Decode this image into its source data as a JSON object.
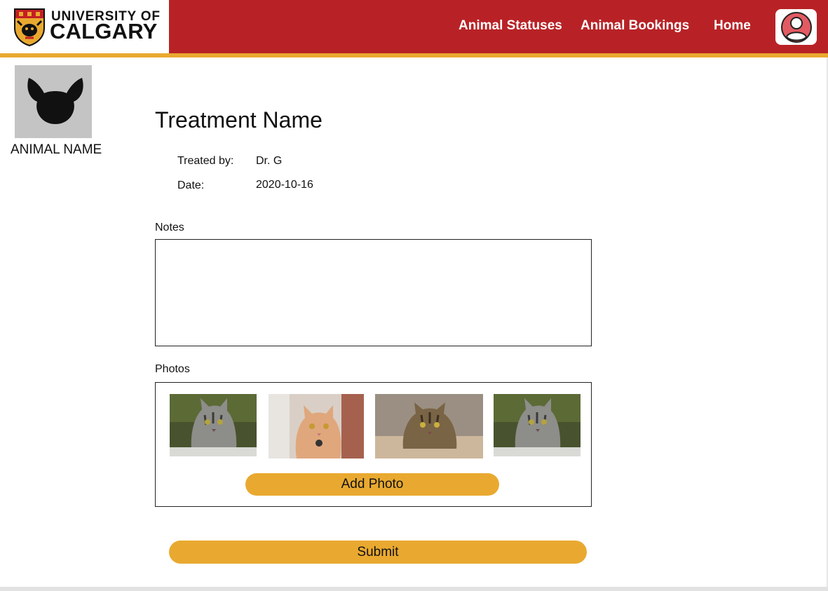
{
  "brand": {
    "line1": "UNIVERSITY OF",
    "line2": "CALGARY",
    "crest_icon": "university-crest-icon"
  },
  "nav": {
    "animal_statuses": "Animal Statuses",
    "animal_bookings": "Animal Bookings",
    "home": "Home",
    "profile_icon": "user-avatar-icon"
  },
  "colors": {
    "header_red": "#b82226",
    "accent_gold": "#e9a930",
    "placeholder_gray": "#c4c4c4"
  },
  "animal": {
    "name": "ANIMAL NAME",
    "image_icon": "animal-silhouette-icon"
  },
  "treatment": {
    "title": "Treatment Name",
    "treated_by_label": "Treated by:",
    "treated_by_value": "Dr. G",
    "date_label": "Date:",
    "date_value": "2020-10-16"
  },
  "notes": {
    "label": "Notes",
    "value": "",
    "placeholder": ""
  },
  "photos": {
    "label": "Photos",
    "items": [
      {
        "name": "photo-tabby-cat-1"
      },
      {
        "name": "photo-orange-cat"
      },
      {
        "name": "photo-tabby-cat-2"
      },
      {
        "name": "photo-tabby-cat-3"
      }
    ],
    "add_label": "Add Photo"
  },
  "actions": {
    "submit_label": "Submit"
  }
}
